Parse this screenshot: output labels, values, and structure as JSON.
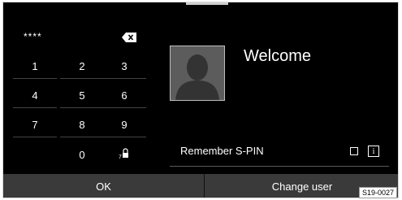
{
  "pin": {
    "masked_value": "****"
  },
  "keypad": {
    "keys": [
      "1",
      "2",
      "3",
      "4",
      "5",
      "6",
      "7",
      "8",
      "9",
      "0"
    ]
  },
  "user": {
    "greeting": "Welcome"
  },
  "remember": {
    "label": "Remember S-PIN",
    "info_label": "i"
  },
  "bottom_bar": {
    "ok_label": "OK",
    "change_user_label": "Change user"
  },
  "figure_code": "S19-0027",
  "icons": {
    "backspace": "backspace-icon",
    "lock_key": "lock-icon",
    "avatar": "user-avatar-icon",
    "info": "info-icon",
    "checkbox": "checkbox-icon"
  }
}
